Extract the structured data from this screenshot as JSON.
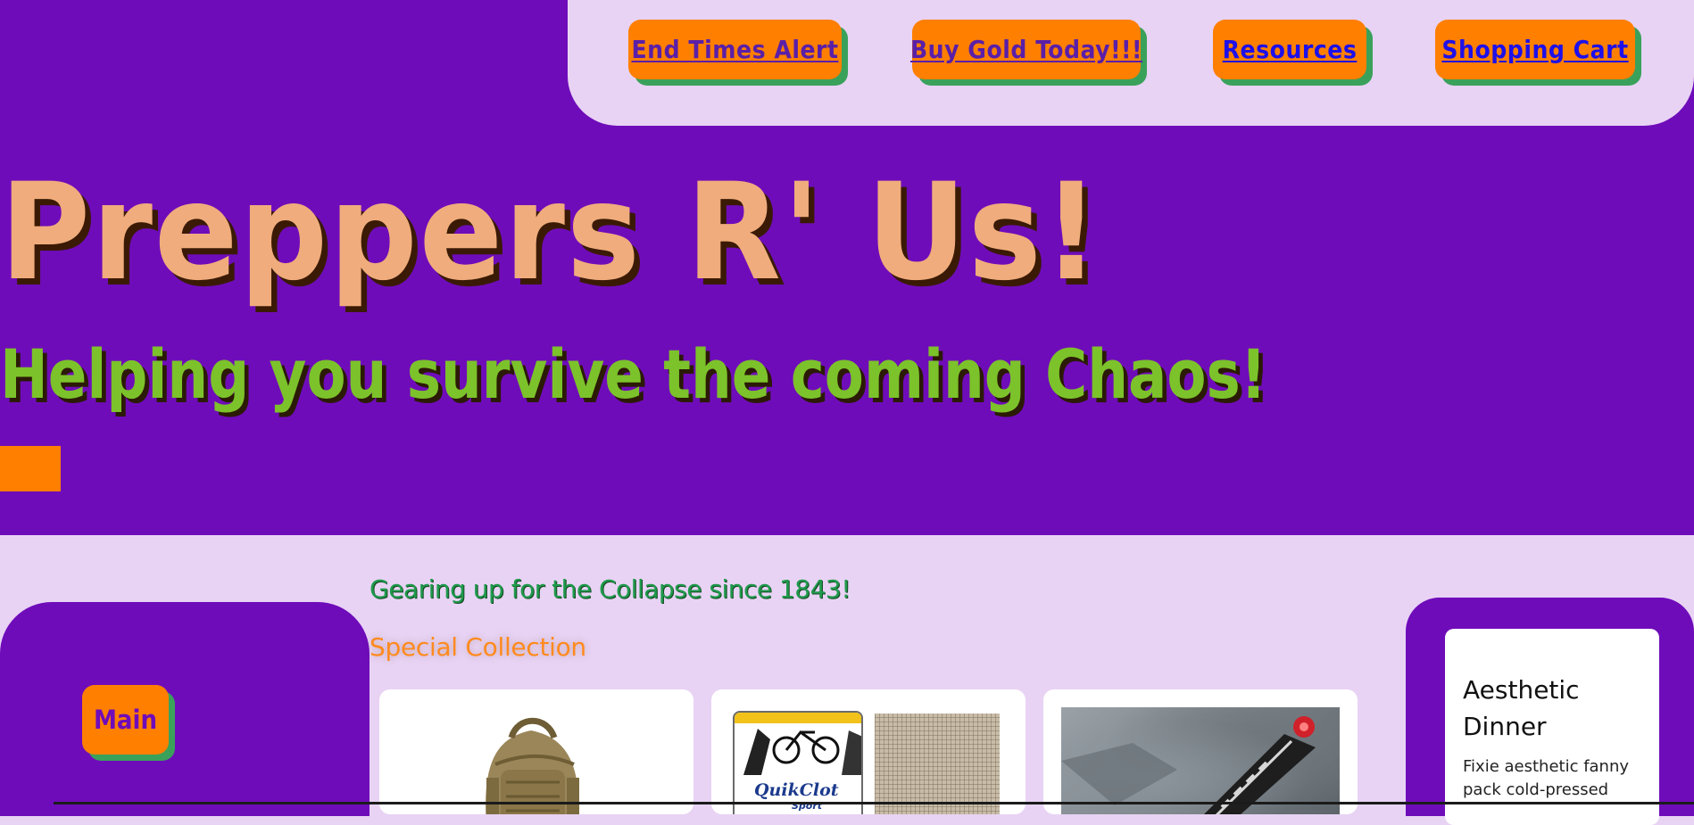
{
  "nav": {
    "items": [
      {
        "label": "End Times Alert"
      },
      {
        "label": "Buy Gold Today!!!"
      },
      {
        "label": "Resources"
      },
      {
        "label": "Shopping Cart"
      }
    ]
  },
  "hero": {
    "title": "Preppers R' Us!",
    "tagline": "Helping you survive the coming Chaos!"
  },
  "sidebar": {
    "main_label": "Main"
  },
  "content": {
    "since_text": "Gearing up for the Collapse since 1843!",
    "section_heading": "Special Collection",
    "products": [
      {
        "image": "tactical-backpack"
      },
      {
        "image": "quikclot-sport-gauze",
        "brand": "QuikClot",
        "sub": "Sport"
      },
      {
        "image": "multitool-card"
      }
    ]
  },
  "aside": {
    "card_title": "Aesthetic Dinner",
    "card_body": "Fixie aesthetic fanny pack cold-pressed"
  },
  "colors": {
    "hero_bg": "#6f0cba",
    "page_bg": "#e8d3f4",
    "button_bg": "#ff7f00",
    "button_shadow": "#3aa15b",
    "title": "#f0ac7c",
    "tagline": "#7cc22b"
  }
}
